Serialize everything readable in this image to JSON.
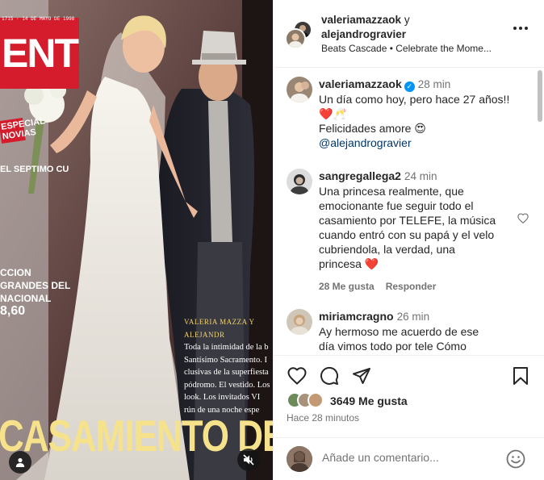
{
  "media": {
    "magazine_logo": "ENTE",
    "magazine_date": "1715 · 14 DE MAYO DE 1998",
    "special_badge": "ESPECIAL NOVIAS",
    "left_line": "EL SEPTIMO CU",
    "left_copy": [
      "CCION",
      "GRANDES DEL",
      "NACIONAL",
      "8,60"
    ],
    "caption_head": "VALERIA MAZZA Y ALEJANDR",
    "caption_lines": [
      "Toda la intimidad de la b",
      "Santísimo Sacramento. I",
      "clusivas de la superfiesta",
      "pódromo. El vestido. Los",
      "look. Los invitados VI",
      "rún de una noche espe"
    ],
    "headline": "CASAMIENTO DEL A"
  },
  "header": {
    "user1": "valeriamazzaok",
    "conjunction": "y",
    "user2": "alejandrogravier",
    "music": "Beats Cascade • Celebrate the Mome..."
  },
  "comments": [
    {
      "user": "valeriamazzaok",
      "verified": true,
      "time": "28 min",
      "lines": [
        "Un día como hoy, pero hace 27 años!!",
        "❤️🥂",
        "Felicidades amore 😍"
      ],
      "mention": "@alejandrogravier"
    },
    {
      "user": "sangregallega2",
      "time": "24 min",
      "text": "Una princesa realmente, que emocionante fue seguir todo el casamiento por TELEFE, la música cuando entró con su papá y el velo cubriendola, la verdad, una princesa ❤️",
      "likes": "28 Me gusta",
      "reply": "Responder"
    },
    {
      "user": "miriamcragno",
      "time": "26 min",
      "text": "Ay hermoso me acuerdo de ese día vimos todo por tele Cómo"
    }
  ],
  "actions": {
    "likes": "3649 Me gusta",
    "ago": "Hace 28 minutos"
  },
  "add_comment": {
    "placeholder": "Añade un comentario..."
  },
  "icons": {
    "like": "heart-icon",
    "comment": "comment-icon",
    "share": "share-icon",
    "save": "bookmark-icon",
    "emoji": "emoji-icon",
    "more": "more-icon",
    "user_tag": "user-icon",
    "mute": "mute-icon"
  },
  "colors": {
    "verified": "#0095f6",
    "mention": "#00376b",
    "heart": "#e0245e",
    "magazine_red": "#d41c2c"
  }
}
